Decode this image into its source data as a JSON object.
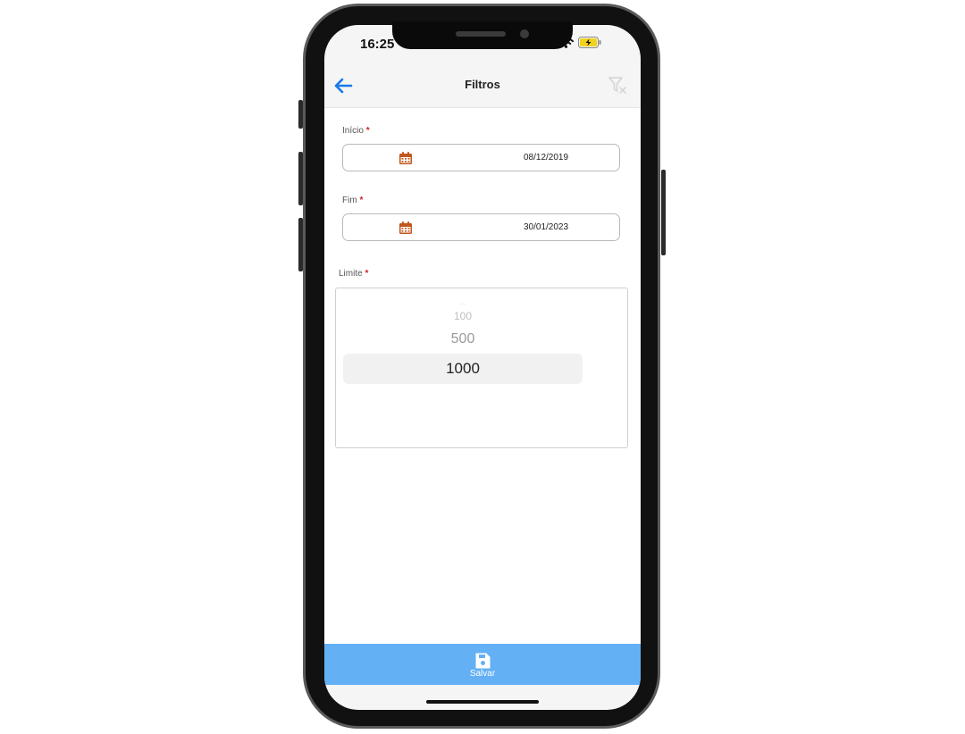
{
  "status_bar": {
    "time": "16:25"
  },
  "header": {
    "title": "Filtros"
  },
  "fields": [
    {
      "label": "Início",
      "required_mark": "*",
      "value": "08/12/2019"
    },
    {
      "label": "Fim",
      "required_mark": "*",
      "value": "30/01/2023"
    }
  ],
  "limit": {
    "label": "Limite",
    "required_mark": "*",
    "options": [
      "...",
      "100",
      "500",
      "1000"
    ],
    "selected": "1000"
  },
  "footer": {
    "save_label": "Salvar"
  },
  "colors": {
    "accent": "#1a7ae8",
    "calendar": "#c0571d",
    "footer": "#64b0f5",
    "required": "#d11f1f"
  },
  "icons": [
    "back-arrow-icon",
    "filter-clear-icon",
    "calendar-icon",
    "save-icon",
    "wifi-icon",
    "battery-icon"
  ]
}
